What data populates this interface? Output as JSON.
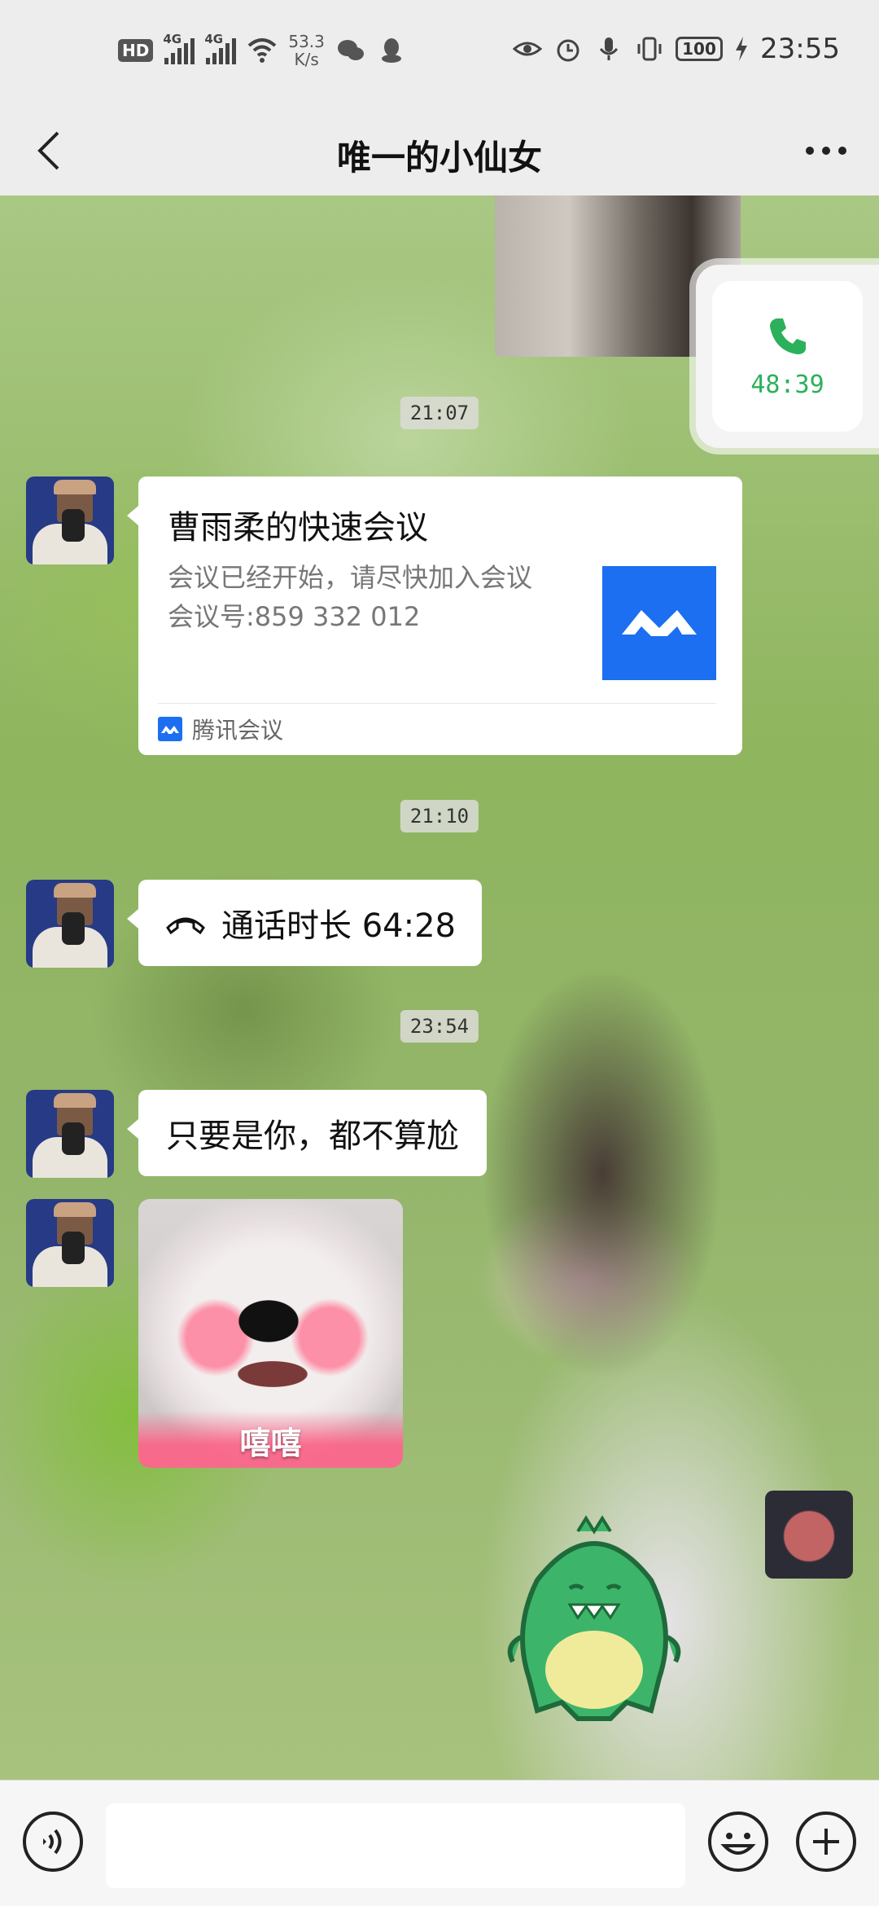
{
  "status_bar": {
    "hd_label": "HD",
    "sim1_label": "4G",
    "sim2_label": "4G",
    "net_speed_value": "53.3",
    "net_speed_unit": "K/s",
    "battery_level": "100",
    "time": "23:55",
    "icons": [
      "hd-icon",
      "signal-icon",
      "signal-icon",
      "wifi-icon",
      "wechat-icon",
      "qq-icon",
      "eye-icon",
      "alarm-icon",
      "mic-icon",
      "vibrate-icon",
      "battery-icon",
      "charging-icon"
    ]
  },
  "header": {
    "title": "唯一的小仙女",
    "back_icon": "chevron-left-icon",
    "more_icon": "more-icon"
  },
  "floating_call": {
    "duration": "48:39",
    "icon": "phone-icon",
    "color": "#2bb05b"
  },
  "messages": {
    "time1": "21:07",
    "time2": "21:10",
    "time3": "23:54",
    "meeting_card": {
      "title": "曹雨柔的快速会议",
      "body": "会议已经开始，请尽快加入会议",
      "meeting_id": "会议号:859 332 012",
      "source": "腾讯会议",
      "accent": "#1b6ff0"
    },
    "call_record": {
      "label": "通话时长 64:28",
      "icon": "phone-hangup-icon"
    },
    "text": "只要是你，都不算尬",
    "sticker_caption": "嘻嘻"
  },
  "input_bar": {
    "voice_icon": "voice-icon",
    "emoji_icon": "emoji-icon",
    "plus_icon": "plus-icon",
    "input_value": ""
  }
}
